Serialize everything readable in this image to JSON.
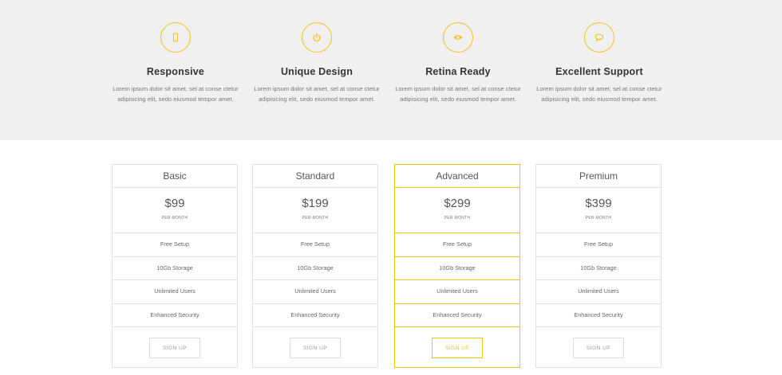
{
  "accent_color": "#f2c21b",
  "features": [
    {
      "icon": "mobile-icon",
      "title": "Responsive",
      "text": "Lorem ipsum dolor sit amet, sel at conse ctetur adipisicing elit, sedo eiusmod tempor amet."
    },
    {
      "icon": "power-icon",
      "title": "Unique Design",
      "text": "Lorem ipsum dolor sit amet, sel at conse ctetur adipisicing elit, sedo eiusmod tempor amet."
    },
    {
      "icon": "eye-icon",
      "title": "Retina Ready",
      "text": "Lorem ipsum dolor sit amet, sel at conse ctetur adipisicing elit, sedo eiusmod tempor amet."
    },
    {
      "icon": "speech-bubble-icon",
      "title": "Excellent Support",
      "text": "Lorem ipsum dolor sit amet, sel at conse ctetur adipisicing elit, sedo eiusmod tempor amet."
    }
  ],
  "plans": [
    {
      "name": "Basic",
      "price": "$99",
      "period": "PER MONTH",
      "features": [
        "Free Setup",
        "10Gb Storage",
        "Unlimited Users",
        "Enhanced Security"
      ],
      "button": "SIGN UP"
    },
    {
      "name": "Standard",
      "price": "$199",
      "period": "PER MONTH",
      "features": [
        "Free Setup",
        "10Gb Storage",
        "Unlimited Users",
        "Enhanced Security"
      ],
      "button": "SIGN UP"
    },
    {
      "name": "Advanced",
      "price": "$299",
      "period": "PER MONTH",
      "features": [
        "Free Setup",
        "10Gb Storage",
        "Unlimited Users",
        "Enhanced Security"
      ],
      "button": "SIGN UP",
      "highlighted": true
    },
    {
      "name": "Premium",
      "price": "$399",
      "period": "PER MONTH",
      "features": [
        "Free Setup",
        "10Gb Storage",
        "Unlimited Users",
        "Enhanced Security"
      ],
      "button": "SIGN UP"
    }
  ]
}
